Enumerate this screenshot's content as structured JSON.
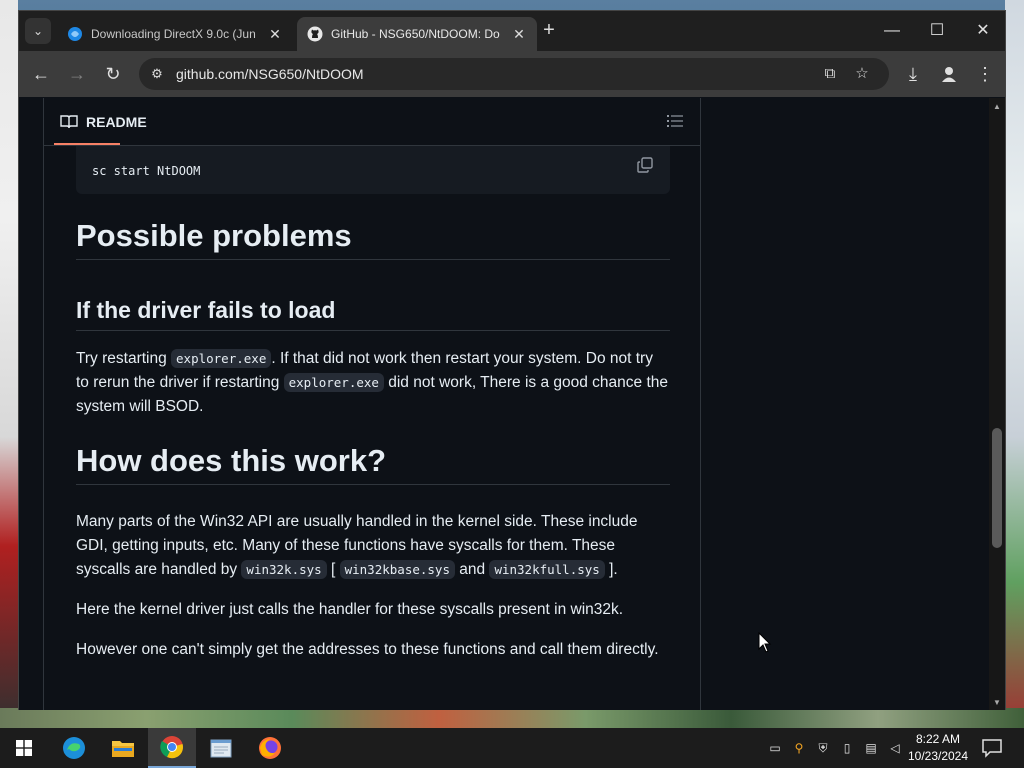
{
  "browser": {
    "tabs": [
      {
        "title": "Downloading DirectX 9.0c (Jun",
        "active": false,
        "close": "✕"
      },
      {
        "title": "GitHub - NSG650/NtDOOM: Do",
        "active": true,
        "close": "✕"
      }
    ],
    "new_tab": "+",
    "url": "github.com/NSG650/NtDOOM",
    "window_controls": {
      "minimize": "—",
      "maximize": "☐",
      "close": "✕"
    }
  },
  "readme": {
    "tab_label": "README",
    "code_line": "sc start NtDOOM",
    "h1_problems": "Possible problems",
    "h2_driver": "If the driver fails to load",
    "p1": {
      "t1": "Try restarting ",
      "c1": "explorer.exe",
      "t2": ". If that did not work then restart your system. Do not try to rerun the driver if restarting ",
      "c2": "explorer.exe",
      "t3": " did not work, There is a good chance the system will BSOD."
    },
    "h1_how": "How does this work?",
    "p2": {
      "t1": "Many parts of the Win32 API are usually handled in the kernel side. These include GDI, getting inputs, etc. Many of these functions have syscalls for them. These syscalls are handled by ",
      "c1": "win32k.sys",
      "t2": " [ ",
      "c2": "win32kbase.sys",
      "t3": " and ",
      "c3": "win32kfull.sys",
      "t4": " ]."
    },
    "p3": "Here the kernel driver just calls the handler for these syscalls present in win32k.",
    "p4": "However one can't simply get the addresses to these functions and call them directly."
  },
  "taskbar": {
    "time": "8:22 AM",
    "date": "10/23/2024",
    "apps": [
      "start-icon",
      "edge-icon",
      "file-explorer-icon",
      "chrome-icon",
      "notepad-icon",
      "firefox-icon"
    ]
  },
  "colors": {
    "page_bg": "#0d1117",
    "text": "#e6edf3",
    "border": "#30363d",
    "accent_underline": "#f78166"
  }
}
